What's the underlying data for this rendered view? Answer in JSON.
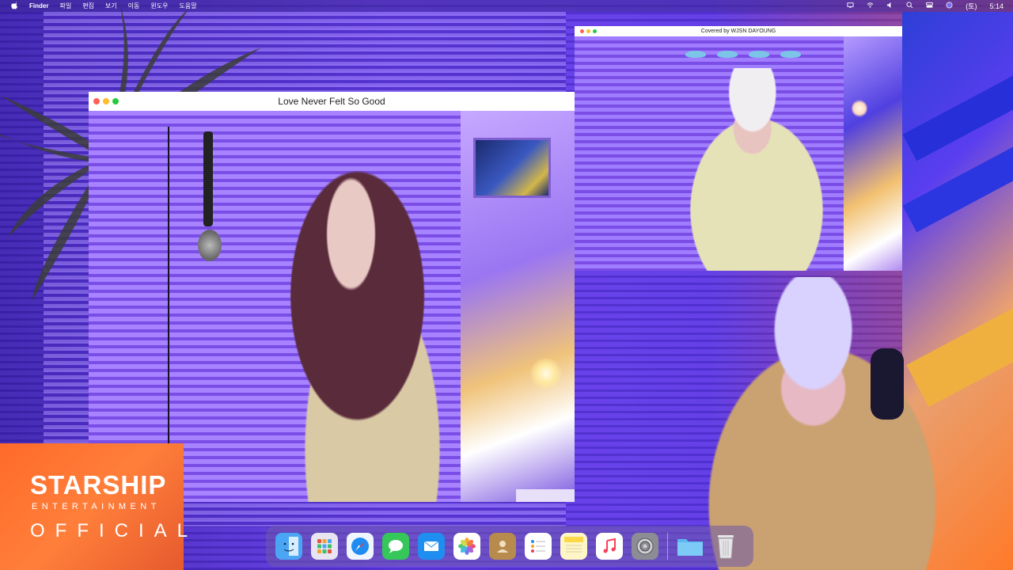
{
  "menubar": {
    "apple_icon": "apple-icon",
    "app_name": "Finder",
    "menus": [
      "파일",
      "편집",
      "보기",
      "이동",
      "윈도우",
      "도움말"
    ],
    "status_icons": [
      "display-icon",
      "wifi-icon",
      "volume-icon",
      "search-icon",
      "control-center-icon",
      "siri-icon"
    ],
    "clock_day": "(토)",
    "clock_time": "5:14"
  },
  "windows": [
    {
      "title": "Love Never Felt So Good"
    },
    {
      "title": "Covered by WJSN DAYOUNG"
    }
  ],
  "logo": {
    "brand": "STARSHIP",
    "sub": "ENTERTAINMENT",
    "official": "OFFICIAL"
  },
  "dock": {
    "items": [
      {
        "name": "finder",
        "icon": "finder-icon",
        "color": "#4aa6f5"
      },
      {
        "name": "launchpad",
        "icon": "launchpad-icon",
        "color": "#e9e4f2"
      },
      {
        "name": "safari",
        "icon": "safari-icon",
        "color": "#f0f6ff"
      },
      {
        "name": "messages",
        "icon": "messages-icon",
        "color": "#35c759"
      },
      {
        "name": "mail",
        "icon": "mail-icon",
        "color": "#1e8ef0"
      },
      {
        "name": "photos",
        "icon": "photos-icon",
        "color": "#ffffff"
      },
      {
        "name": "contacts",
        "icon": "contacts-icon",
        "color": "#b78a4e"
      },
      {
        "name": "reminders",
        "icon": "reminders-icon",
        "color": "#ffffff"
      },
      {
        "name": "notes",
        "icon": "notes-icon",
        "color": "#ffd84a"
      },
      {
        "name": "music",
        "icon": "music-icon",
        "color": "#fa3f5a"
      },
      {
        "name": "system-preferences",
        "icon": "gear-icon",
        "color": "#8c8c94"
      },
      {
        "name": "downloads-folder",
        "icon": "folder-icon",
        "color": "#5cb8f0"
      },
      {
        "name": "trash",
        "icon": "trash-icon",
        "color": "#e6e6ea"
      }
    ]
  }
}
